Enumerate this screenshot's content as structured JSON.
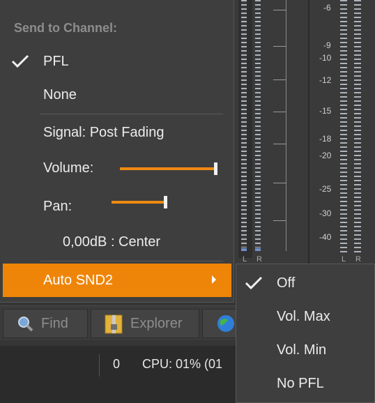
{
  "menu": {
    "header": "Send to Channel:",
    "items": {
      "pfl": {
        "label": "PFL",
        "checked": true
      },
      "none": {
        "label": "None"
      },
      "signal": {
        "label": "Signal: Post Fading"
      },
      "volume": {
        "label": "Volume:",
        "level": 1.0
      },
      "pan": {
        "label": "Pan:",
        "level": 0.5
      },
      "pan_readout": "0,00dB : Center",
      "auto": {
        "label": "Auto SND2"
      }
    }
  },
  "submenu": {
    "items": [
      {
        "label": "Off",
        "checked": true
      },
      {
        "label": "Vol. Max"
      },
      {
        "label": "Vol. Min"
      },
      {
        "label": "No PFL"
      }
    ]
  },
  "meters": {
    "db_labels": [
      "-6",
      "-9",
      "-10",
      "-12",
      "-15",
      "-18",
      "-20",
      "-25",
      "-30",
      "-40"
    ],
    "channel_labels": [
      "L",
      "R"
    ]
  },
  "toolbar": {
    "find_label": "Find",
    "explorer_label": "Explorer"
  },
  "status": {
    "count": "0",
    "cpu": "CPU: 01% (01"
  },
  "colors": {
    "accent": "#ef8508",
    "menu_bg": "#3e3e3e"
  }
}
